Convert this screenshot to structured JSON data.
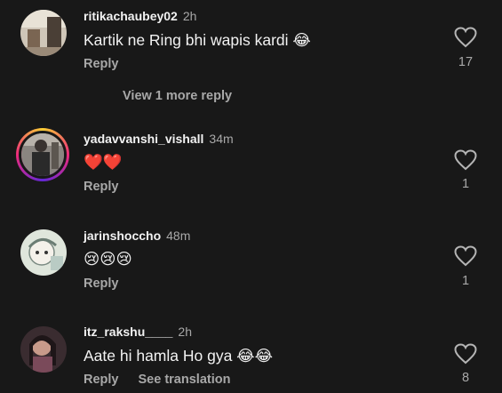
{
  "comments": [
    {
      "username": "ritikachaubey02",
      "time": "2h",
      "text": "Kartik ne Ring bhi wapis kardi 😂",
      "reply": "Reply",
      "likes": "17",
      "extra": ""
    },
    {
      "username": "yadavvanshi_vishall",
      "time": "34m",
      "text": "❤️❤️",
      "reply": "Reply",
      "likes": "1",
      "extra": ""
    },
    {
      "username": "jarinshoccho",
      "time": "48m",
      "text": "😢😢😢",
      "reply": "Reply",
      "likes": "1",
      "extra": ""
    },
    {
      "username": "itz_rakshu____",
      "time": "2h",
      "text": "Aate hi hamla Ho gya 😂😂",
      "reply": "Reply",
      "likes": "8",
      "extra": "See translation"
    }
  ],
  "view_more": "View 1 more reply",
  "icons": {
    "like": "heart-outline-icon"
  },
  "colors": {
    "background": "#181818",
    "secondary_text": "#a8a8a8",
    "primary_text": "#f2f2f2"
  }
}
